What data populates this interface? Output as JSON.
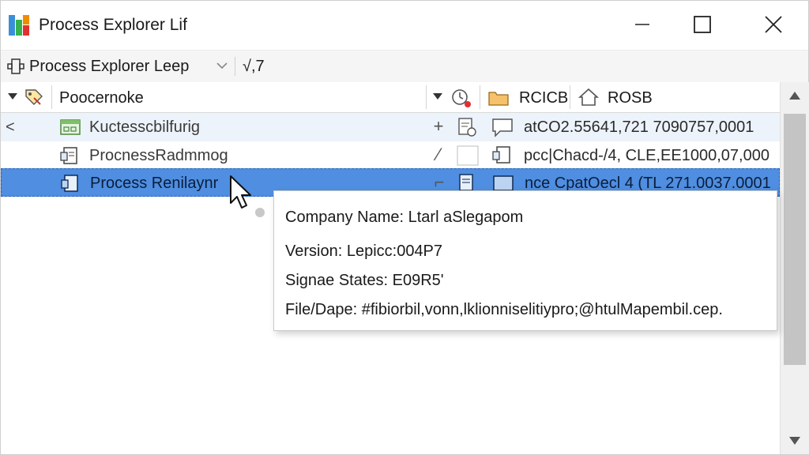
{
  "window": {
    "title": "Process Explorer Lif",
    "controls": {
      "minimize": "minimize",
      "maximize": "maximize",
      "close": "close"
    }
  },
  "toolbar": {
    "dropdown_label": "Process Explorer Leep",
    "extra": "√,7"
  },
  "columns": {
    "name": "Poocernoke",
    "col2": "RCICB",
    "col3": "ROSB"
  },
  "rows": [
    {
      "name": "Kuctesscbilfurig",
      "symbol": "+",
      "value": "atCO2.55641,721 7090757,0001",
      "selected": false,
      "expand": "<"
    },
    {
      "name": "ProcnessRadmmog",
      "symbol": "⁄",
      "value": "pcc|Chacd‐/4, CLE,EE1000,07,000",
      "selected": false,
      "expand": ""
    },
    {
      "name": "Process Renilaynr",
      "symbol": "⌐",
      "value": "nce CpatOecl 4 (TL 271.0037.0001",
      "selected": true,
      "expand": ""
    }
  ],
  "tooltip": {
    "company": "Company Name: Ltarl aSlegapom",
    "version": "Version: Lepicc:004P7",
    "states": "Signae States: E09R5'",
    "file": "File/Dape: #fibiorbil,vonn,lklionniselitiypro;@htulMapembil.cep."
  },
  "colors": {
    "selected_row": "#4f8ee0",
    "alt_row": "#edf3fb",
    "toolbar_bg": "#f5f5f5"
  }
}
